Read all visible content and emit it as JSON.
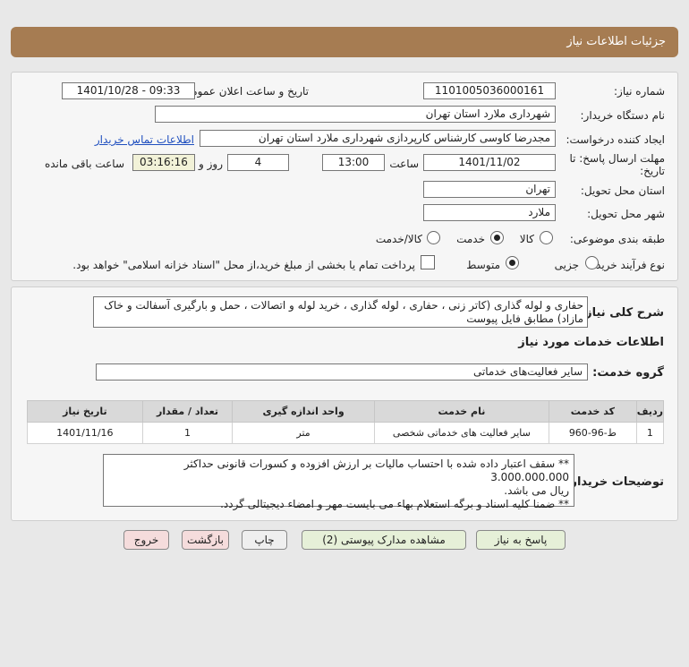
{
  "header": {
    "title": "جزئیات اطلاعات نیاز"
  },
  "form": {
    "need_number_label": "شماره نیاز:",
    "need_number": "1101005036000161",
    "announce_label": "تاریخ و ساعت اعلان عمومی:",
    "announce_value": "1401/10/28 - 09:33",
    "buyer_label": "نام دستگاه خریدار:",
    "buyer_value": "شهرداری ملارد استان تهران",
    "creator_label": "ایجاد کننده درخواست:",
    "creator_value": "مجدرضا کاوسی کارشناس کارپردازی شهرداری ملارد استان تهران",
    "contact_link": "اطلاعات تماس خریدار",
    "deadline_label_1": "مهلت ارسال پاسخ: تا",
    "deadline_label_2": "تاریخ:",
    "deadline_date": "1401/11/02",
    "time_label": "ساعت",
    "deadline_time": "13:00",
    "days_value": "4",
    "days_label": "روز و",
    "remaining_time": "03:16:16",
    "remaining_label": "ساعت باقی مانده",
    "province_label": "استان محل تحویل:",
    "province_value": "تهران",
    "city_label": "شهر محل تحویل:",
    "city_value": "ملارد",
    "category_label": "طبقه بندی موضوعی:",
    "category_options": [
      "کالا",
      "خدمت",
      "کالا/خدمت"
    ],
    "category_selected": "خدمت",
    "process_label": "نوع فرآیند خرید :",
    "process_options": [
      "جزیی",
      "متوسط"
    ],
    "process_selected": "متوسط",
    "payment_note": "پرداخت تمام یا بخشی از مبلغ خرید،از محل \"اسناد خزانه اسلامی\" خواهد بود."
  },
  "details": {
    "summary_label": "شرح کلی نیاز:",
    "summary_text_1": "حفاری و لوله گذاری (کاتر زنی ، حفاری ، لوله گذاری ، خرید لوله و اتصالات ، حمل و بارگیری آسفالت و خاک",
    "summary_text_2": "مازاد) مطابق فایل پیوست",
    "services_heading": "اطلاعات خدمات مورد نیاز",
    "service_group_label": "گروه خدمت:",
    "service_group_value": "سایر فعالیت‌های خدماتی",
    "table_headers": [
      "ردیف",
      "کد خدمت",
      "نام خدمت",
      "واحد اندازه گیری",
      "تعداد / مقدار",
      "تاریخ نیاز"
    ],
    "table_rows": [
      [
        "1",
        "ط-96-960",
        "سایر فعالیت های خدماتی شخصی",
        "متر",
        "1",
        "1401/11/16"
      ]
    ],
    "buyer_notes_label": "توضیحات خریدار:",
    "buyer_notes_1": "** سقف اعتبار داده شده با احتساب مالیات بر ارزش افزوده و کسورات قانونی حداکثر 3.000.000.000",
    "buyer_notes_2": "ریال می باشد.",
    "buyer_notes_3": "** ضمنا کلیه اسناد و برگه استعلام بهاء می بایست مهر و امضاء دیجیتالی گردد."
  },
  "buttons": {
    "reply": "پاسخ به نیاز",
    "attachments": "مشاهده مدارک پیوستی (2)",
    "print": "چاپ",
    "back": "بازگشت",
    "exit": "خروج"
  },
  "colors": {
    "header_bg": "#a67c52",
    "link": "#1f4fbf",
    "reply_bg": "#e6f0d8",
    "exit_bg": "#f5dcdc"
  }
}
